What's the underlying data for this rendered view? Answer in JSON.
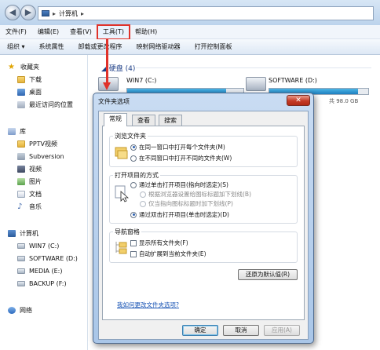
{
  "address": {
    "crumb": "计算机"
  },
  "menu": [
    {
      "label": "文件(F)"
    },
    {
      "label": "编辑(E)"
    },
    {
      "label": "查看(V)"
    },
    {
      "label": "工具(T)",
      "highlighted": true
    },
    {
      "label": "帮助(H)"
    }
  ],
  "toolbar": [
    "组织 ▾",
    "系统属性",
    "卸载或更改程序",
    "映射网络驱动器",
    "打开控制面板"
  ],
  "sidebar": {
    "favorites": {
      "label": "收藏夹",
      "items": [
        "下载",
        "桌面",
        "最近访问的位置"
      ]
    },
    "libraries": {
      "label": "库",
      "items": [
        "PPTV视频",
        "Subversion",
        "视频",
        "图片",
        "文档",
        "音乐"
      ]
    },
    "computer": {
      "label": "计算机",
      "items": [
        "WIN7 (C:)",
        "SOFTWARE (D:)",
        "MEDIA (E:)",
        "BACKUP (F:)"
      ]
    },
    "network": {
      "label": "网络"
    }
  },
  "content": {
    "header": "硬盘 (4)",
    "drives": [
      {
        "name": "WIN7 (C:)",
        "used_fraction": 0.85
      },
      {
        "name": "SOFTWARE (D:)",
        "used_fraction": 0.9,
        "size_text": "共 98.0 GB"
      }
    ]
  },
  "dialog": {
    "title": "文件夹选项",
    "close_glyph": "✕",
    "tabs": [
      "常规",
      "查看",
      "搜索"
    ],
    "browse": {
      "label": "浏览文件夹",
      "options": [
        "在同一窗口中打开每个文件夹(M)",
        "在不同窗口中打开不同的文件夹(W)"
      ]
    },
    "click": {
      "label": "打开项目的方式",
      "options": [
        "通过单击打开项目(指向时选定)(S)",
        "根据浏览器设置给图标标题加下划线(B)",
        "仅当指向图标标题时加下划线(P)",
        "通过双击打开项目(单击时选定)(D)"
      ]
    },
    "nav": {
      "label": "导航窗格",
      "options": [
        "显示所有文件夹(F)",
        "自动扩展到当前文件夹(E)"
      ]
    },
    "restore_button": "还原为默认值(R)",
    "help_link": "我如何更改文件夹选项?",
    "buttons": {
      "ok": "确定",
      "cancel": "取消",
      "apply": "应用(A)"
    }
  }
}
